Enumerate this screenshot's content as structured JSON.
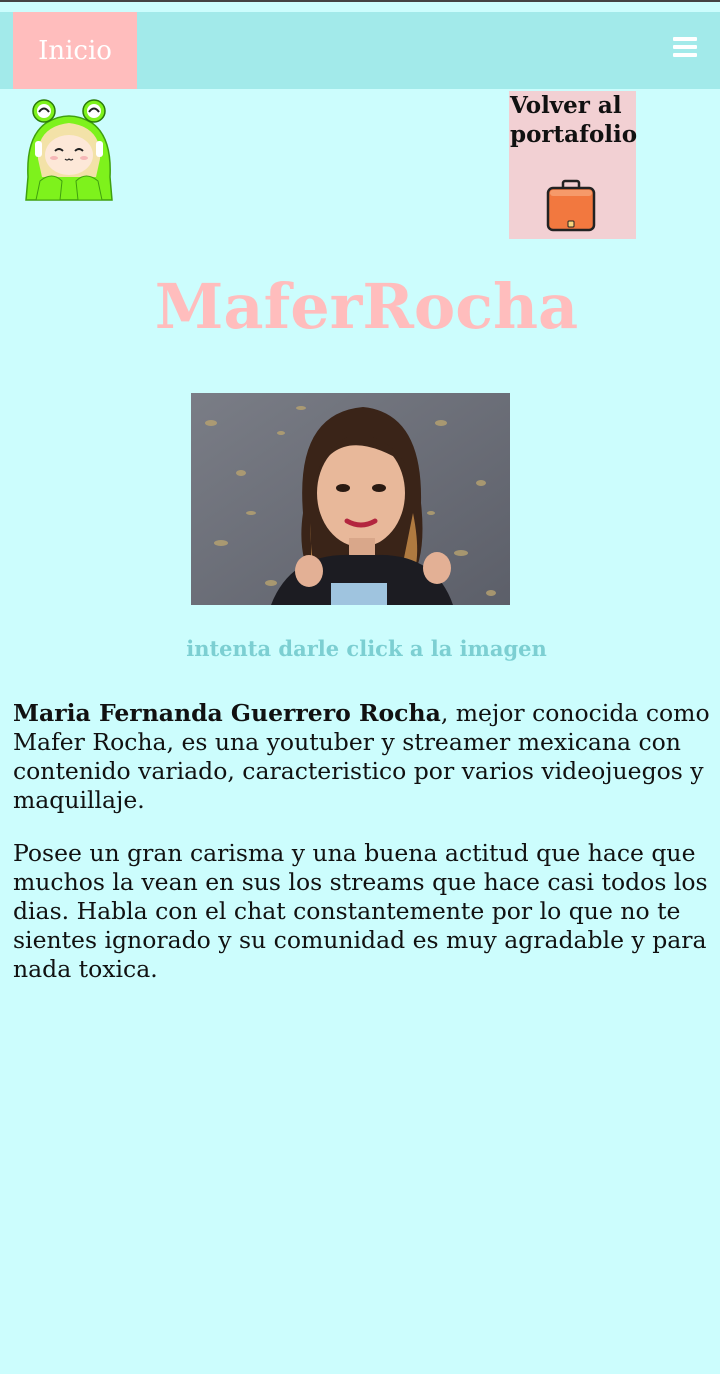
{
  "navbar": {
    "home_label": "Inicio",
    "menu_icon": "hamburger-menu-icon"
  },
  "header": {
    "avatar_icon": "frog-hood-avatar",
    "portfolio_label": "Volver al portafolio",
    "portfolio_icon": "briefcase-icon"
  },
  "main": {
    "title": "MaferRocha",
    "photo_hint": "intenta darle click a la imagen",
    "bio": {
      "p1_name": "Maria Fernanda Guerrero Rocha",
      "p1_rest": ", mejor conocida como Mafer Rocha, es una youtuber y streamer mexicana con contenido variado, caracteristico por varios videojuegos y maquillaje.",
      "p2": "Posee un gran carisma y una buena actitud que hace que muchos la vean en sus los streams que hace casi todos los dias. Habla con el chat constantemente por lo que no te sientes ignorado y su comunidad es muy agradable y para nada toxica."
    }
  },
  "colors": {
    "page_bg": "#ccfdfd",
    "navbar_bg": "#a2eaea",
    "home_bg": "#ffbdbd",
    "title": "#ffbdbd",
    "hint": "#7ccfd2",
    "portfolio_bg": "#f2d0d3"
  }
}
